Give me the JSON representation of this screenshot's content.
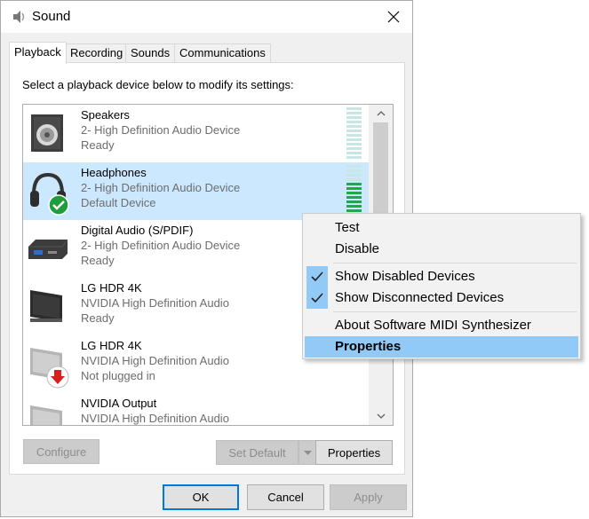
{
  "window": {
    "title": "Sound"
  },
  "tabs": [
    {
      "label": "Playback",
      "active": true
    },
    {
      "label": "Recording"
    },
    {
      "label": "Sounds"
    },
    {
      "label": "Communications"
    }
  ],
  "instruction": "Select a playback device below to modify its settings:",
  "devices": [
    {
      "name": "Speakers",
      "line2": "2- High Definition Audio Device",
      "status": "Ready",
      "icon": "speaker-icon"
    },
    {
      "name": "Headphones",
      "line2": "2- High Definition Audio Device",
      "status": "Default Device",
      "icon": "headphones-icon",
      "selected": true,
      "badge": "green-check-icon"
    },
    {
      "name": "Digital Audio (S/PDIF)",
      "line2": "2- High Definition Audio Device",
      "status": "Ready",
      "icon": "digital-audio-receiver-icon"
    },
    {
      "name": "LG HDR 4K",
      "line2": "NVIDIA High Definition Audio",
      "status": "Ready",
      "icon": "monitor-icon"
    },
    {
      "name": "LG HDR 4K",
      "line2": "NVIDIA High Definition Audio",
      "status": "Not plugged in",
      "icon": "monitor-disabled-icon",
      "badge": "red-down-arrow-icon"
    },
    {
      "name": "NVIDIA Output",
      "line2": "NVIDIA High Definition Audio",
      "status": "",
      "icon": "monitor-disabled-icon"
    }
  ],
  "buttons": {
    "configure": "Configure",
    "set_default": "Set Default",
    "properties": "Properties",
    "ok": "OK",
    "cancel": "Cancel",
    "apply": "Apply"
  },
  "context_menu": [
    {
      "label": "Test"
    },
    {
      "label": "Disable"
    },
    {
      "label": "Show Disabled Devices",
      "checked": true
    },
    {
      "label": "Show Disconnected Devices",
      "checked": true
    },
    {
      "label": "About Software MIDI Synthesizer"
    },
    {
      "label": "Properties",
      "highlighted": true
    }
  ],
  "colors": {
    "selection": "#cce8ff",
    "menu_highlight": "#91c9f7",
    "level_active": "#22a84a",
    "default_button_border": "#0078d7"
  }
}
